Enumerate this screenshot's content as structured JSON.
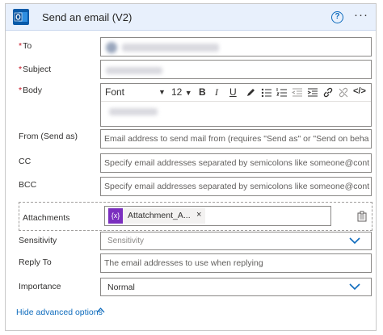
{
  "header": {
    "title": "Send an email (V2)",
    "help_glyph": "?",
    "more_glyph": "···"
  },
  "fields": {
    "to": {
      "label": "To",
      "required": "*"
    },
    "subject": {
      "label": "Subject",
      "required": "*"
    },
    "body": {
      "label": "Body",
      "required": "*",
      "font": "Font",
      "font_size": "12",
      "toolbar_buttons": [
        "B",
        "I",
        "U"
      ]
    },
    "from": {
      "label": "From (Send as)",
      "placeholder": "Email address to send mail from (requires \"Send as\" or \"Send on behalf of\")"
    },
    "cc": {
      "label": "CC",
      "placeholder": "Specify email addresses separated by semicolons like someone@contoso.com"
    },
    "bcc": {
      "label": "BCC",
      "placeholder": "Specify email addresses separated by semicolons like someone@contoso.com"
    },
    "attachments": {
      "label": "Attachments",
      "token_label": "Attatchment_A...",
      "token_glyph": "{x}",
      "token_close": "×"
    },
    "sensitivity": {
      "label": "Sensitivity",
      "placeholder": "Sensitivity"
    },
    "reply_to": {
      "label": "Reply To",
      "placeholder": "The email addresses to use when replying"
    },
    "importance": {
      "label": "Importance",
      "value": "Normal"
    }
  },
  "footer": {
    "advanced_label": "Hide advanced options"
  },
  "colors": {
    "accent": "#0f6cbd",
    "required": "#c50f1f",
    "header_bg": "#e8f0fc",
    "token_icon": "#7b2fbf"
  }
}
